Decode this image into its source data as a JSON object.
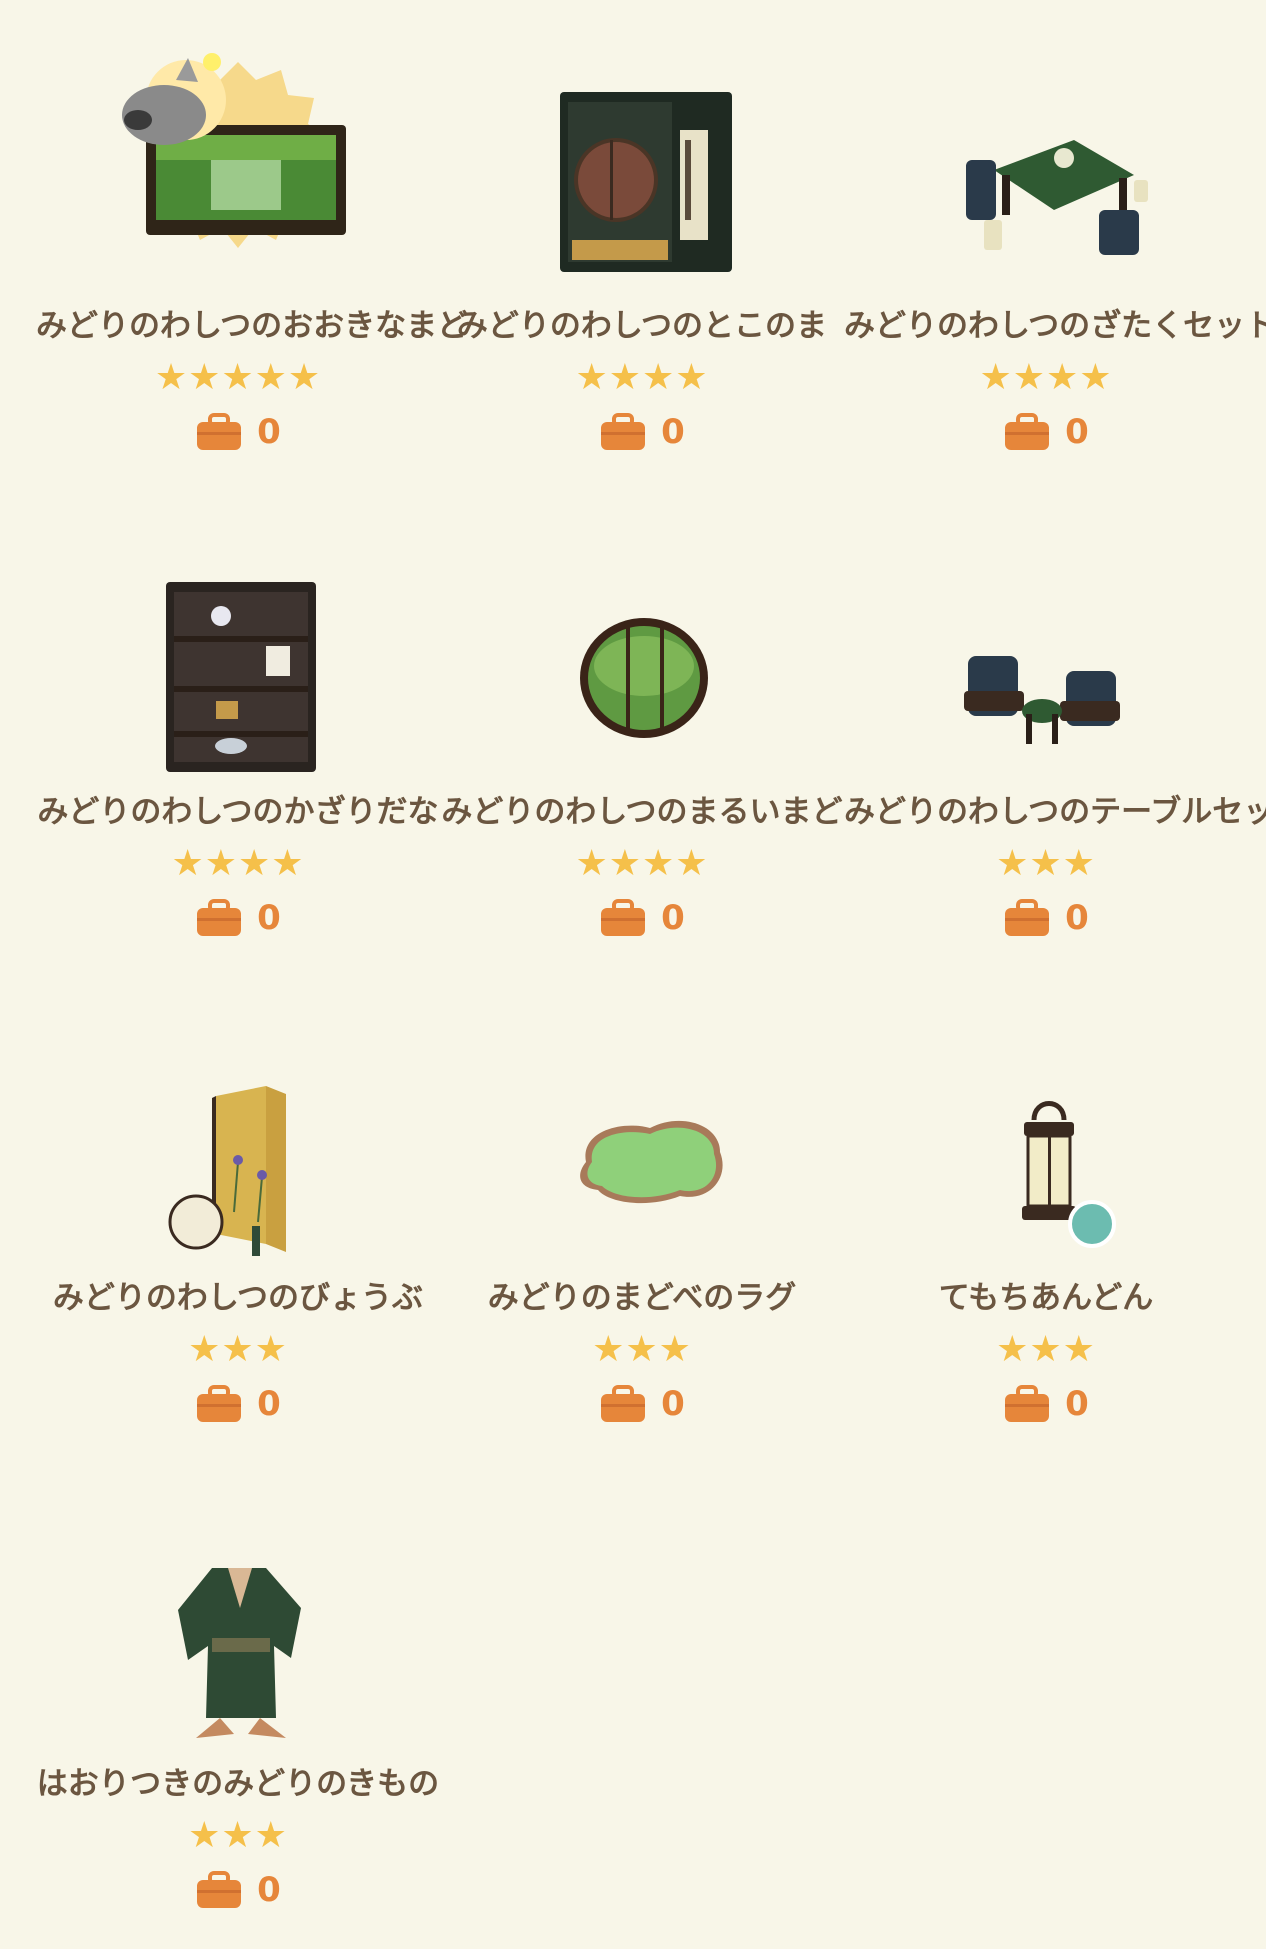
{
  "items": [
    {
      "name": "みどりのわしつのおおきなまど",
      "stars": "★★★★★",
      "count": "0",
      "icon": "large-window-icon"
    },
    {
      "name": "みどりのわしつのとこのま",
      "stars": "★★★★",
      "count": "0",
      "icon": "alcove-icon"
    },
    {
      "name": "みどりのわしつのざたくセット",
      "stars": "★★★★",
      "count": "0",
      "icon": "low-table-set-icon"
    },
    {
      "name": "みどりのわしつのかざりだな",
      "stars": "★★★★",
      "count": "0",
      "icon": "display-shelf-icon"
    },
    {
      "name": "みどりのわしつのまるいまど",
      "stars": "★★★★",
      "count": "0",
      "icon": "round-window-icon"
    },
    {
      "name": "みどりのわしつのテーブルセット",
      "stars": "★★★",
      "count": "0",
      "icon": "table-set-icon"
    },
    {
      "name": "みどりのわしつのびょうぶ",
      "stars": "★★★",
      "count": "0",
      "icon": "folding-screen-icon"
    },
    {
      "name": "みどりのまどべのラグ",
      "stars": "★★★",
      "count": "0",
      "icon": "rug-icon"
    },
    {
      "name": "てもちあんどん",
      "stars": "★★★",
      "count": "0",
      "icon": "hand-lantern-icon"
    },
    {
      "name": "はおりつきのみどりのきもの",
      "stars": "★★★",
      "count": "0",
      "icon": "kimono-icon"
    }
  ],
  "colors": {
    "background": "#f8f6e8",
    "star": "#f5c04a",
    "count": "#e6863a",
    "text": "#6b5640"
  }
}
